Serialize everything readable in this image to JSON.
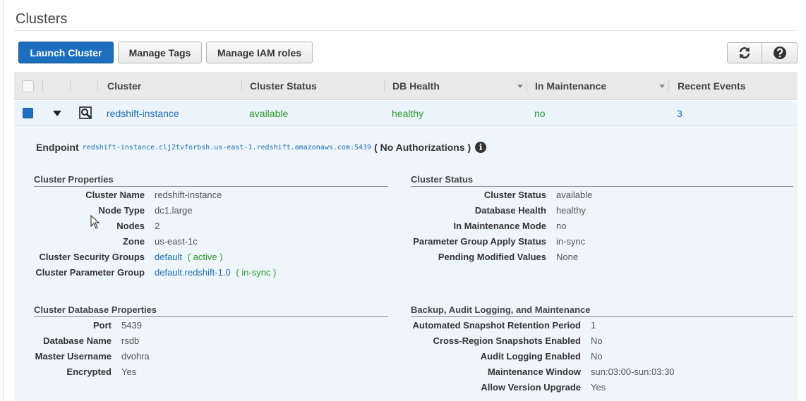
{
  "page_title": "Clusters",
  "toolbar": {
    "launch_label": "Launch Cluster",
    "tags_label": "Manage Tags",
    "iam_label": "Manage IAM roles",
    "refresh_icon": "refresh-icon",
    "help_icon": "help-icon"
  },
  "table": {
    "headers": [
      "Cluster",
      "Cluster Status",
      "DB Health",
      "In Maintenance",
      "Recent Events"
    ],
    "row": {
      "cluster": "redshift-instance",
      "status": "available",
      "health": "healthy",
      "maintenance": "no",
      "events": "3"
    }
  },
  "details": {
    "endpoint_label": "Endpoint",
    "endpoint_value": "redshift-instance.clj2tvforbsh.us-east-1.redshift.amazonaws.com:5439",
    "authorization": "( No Authorizations )",
    "cluster_properties": {
      "title": "Cluster Properties",
      "cluster_name_label": "Cluster Name",
      "cluster_name": "redshift-instance",
      "node_type_label": "Node Type",
      "node_type": "dc1.large",
      "nodes_label": "Nodes",
      "nodes": "2",
      "zone_label": "Zone",
      "zone": "us-east-1c",
      "security_groups_label": "Cluster Security Groups",
      "security_group": "default",
      "security_group_status": "( active )",
      "param_group_label": "Cluster Parameter Group",
      "param_group": "default.redshift-1.0",
      "param_group_status": "( in-sync )"
    },
    "cluster_status": {
      "title": "Cluster Status",
      "status_label": "Cluster Status",
      "status": "available",
      "db_health_label": "Database Health",
      "db_health": "healthy",
      "maintenance_label": "In Maintenance Mode",
      "maintenance": "no",
      "param_apply_label": "Parameter Group Apply Status",
      "param_apply": "in-sync",
      "pending_label": "Pending Modified Values",
      "pending": "None"
    },
    "db_properties": {
      "title": "Cluster Database Properties",
      "port_label": "Port",
      "port": "5439",
      "db_name_label": "Database Name",
      "db_name": "rsdb",
      "master_label": "Master Username",
      "master": "dvohra",
      "encrypted_label": "Encrypted",
      "encrypted": "Yes"
    },
    "backup": {
      "title": "Backup, Audit Logging, and Maintenance",
      "snapshot_retention_label": "Automated Snapshot Retention Period",
      "snapshot_retention": "1",
      "cross_region_label": "Cross-Region Snapshots Enabled",
      "cross_region": "No",
      "audit_label": "Audit Logging Enabled",
      "audit": "No",
      "window_label": "Maintenance Window",
      "window": "sun:03:00-sun:03:30",
      "upgrade_label": "Allow Version Upgrade",
      "upgrade": "Yes"
    }
  },
  "colors": {
    "primary": "#1c6fbf",
    "link": "#1f6fb1",
    "success": "#2b9a2b",
    "row_selected": "#ebf4fb"
  }
}
